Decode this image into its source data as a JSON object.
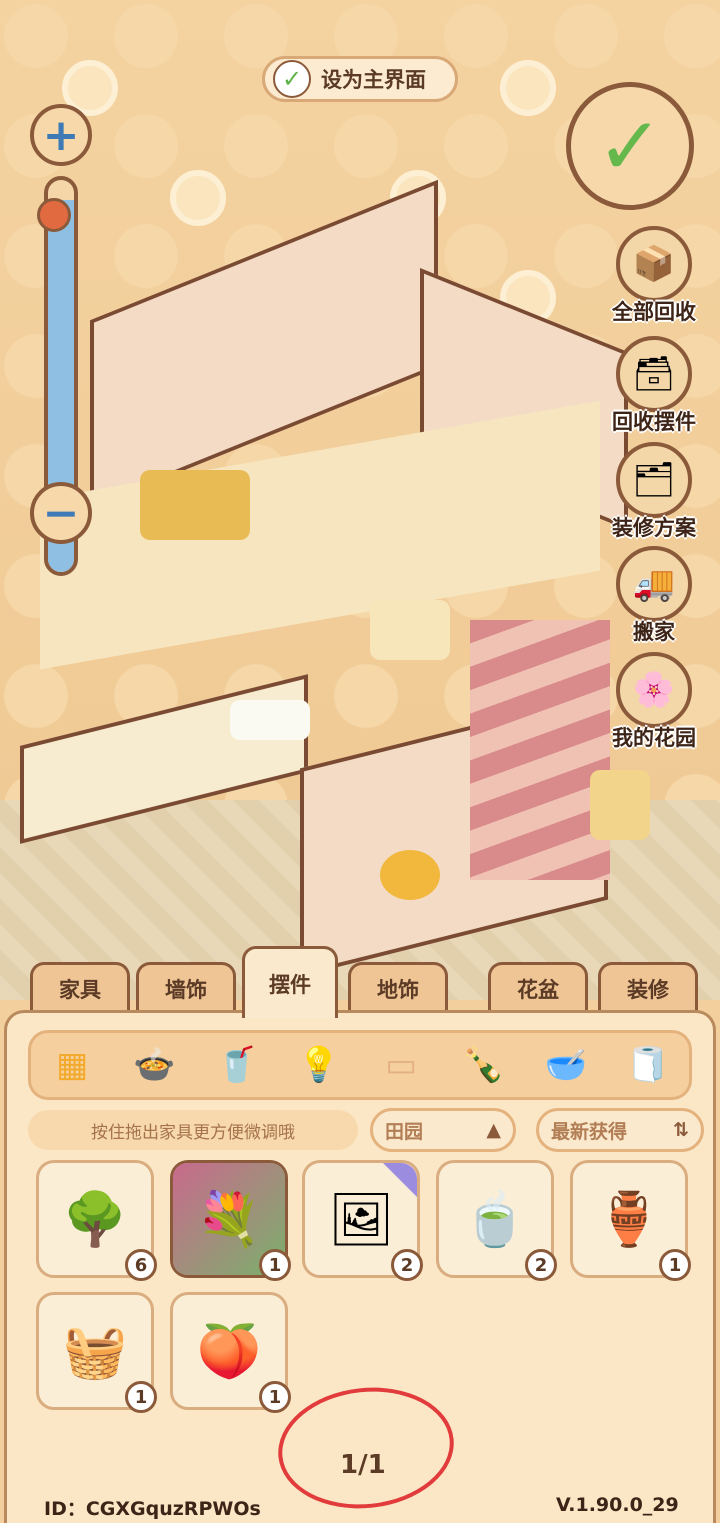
{
  "top": {
    "set_main_label": "设为主界面"
  },
  "zoom": {
    "plus_icon": "plus-icon",
    "minus_icon": "minus-icon",
    "level": 0.95
  },
  "side_buttons": [
    {
      "label": "全部回收",
      "icon": "recycle-all-icon",
      "glyph": "📦"
    },
    {
      "label": "回收摆件",
      "icon": "recycle-ornaments-icon",
      "glyph": "🗃"
    },
    {
      "label": "装修方案",
      "icon": "decoration-plan-icon",
      "glyph": "🗂"
    },
    {
      "label": "搬家",
      "icon": "moving-truck-icon",
      "glyph": "🚚"
    },
    {
      "label": "我的花园",
      "icon": "garden-arch-icon",
      "glyph": "🌸"
    }
  ],
  "tabs": [
    {
      "label": "家具",
      "active": false
    },
    {
      "label": "墙饰",
      "active": false
    },
    {
      "label": "摆件",
      "active": true
    },
    {
      "label": "地饰",
      "active": false
    },
    {
      "label": "花盆",
      "active": false
    },
    {
      "label": "装修",
      "active": false
    }
  ],
  "subcategories": [
    {
      "icon": "grid-all-icon",
      "glyph": "▦",
      "active": true
    },
    {
      "icon": "pot-icon",
      "glyph": "🍲",
      "active": false
    },
    {
      "icon": "cup-icon",
      "glyph": "🥤",
      "active": false
    },
    {
      "icon": "lamp-icon",
      "glyph": "💡",
      "active": false
    },
    {
      "icon": "pillow-icon",
      "glyph": "▭",
      "active": false
    },
    {
      "icon": "bottle-icon",
      "glyph": "🍾",
      "active": false
    },
    {
      "icon": "pet-bowl-icon",
      "glyph": "🥣",
      "active": false
    },
    {
      "icon": "tissue-roll-icon",
      "glyph": "🧻",
      "active": false
    }
  ],
  "hint": "按住拖出家具更方便微调哦",
  "filter": {
    "label": "田园",
    "icon": "triangle-up-icon"
  },
  "sort": {
    "label": "最新获得",
    "icon": "sort-icon"
  },
  "items": [
    {
      "name": "orange-bonsai",
      "glyph": "🌳",
      "count": "6",
      "selected": false,
      "new": false
    },
    {
      "name": "flower-bouquet",
      "glyph": "💐",
      "count": "1",
      "selected": true,
      "new": false
    },
    {
      "name": "photo-frame",
      "glyph": "🖼",
      "count": "2",
      "selected": false,
      "new": true
    },
    {
      "name": "tea-set",
      "glyph": "🍵",
      "count": "2",
      "selected": false,
      "new": false
    },
    {
      "name": "wine-jar",
      "glyph": "🏺",
      "count": "1",
      "selected": false,
      "new": false
    },
    {
      "name": "bamboo-steamer",
      "glyph": "🧺",
      "count": "1",
      "selected": false,
      "new": false
    },
    {
      "name": "fruit-plate",
      "glyph": "🍑",
      "count": "1",
      "selected": false,
      "new": false
    }
  ],
  "pager": "1/1",
  "footer": {
    "id": "ID：CGXGquzRPWOs",
    "version": "V.1.90.0_29"
  }
}
